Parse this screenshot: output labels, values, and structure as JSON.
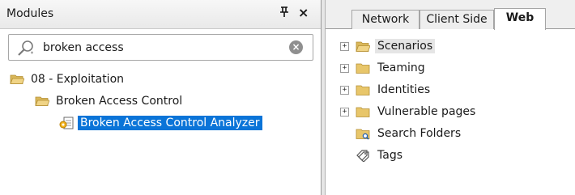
{
  "modules_panel": {
    "title": "Modules",
    "pin_glyph": "p",
    "close_glyph": "×",
    "search": {
      "value": "broken access",
      "placeholder": ""
    },
    "tree": [
      {
        "label": "08 - Exploitation",
        "icon": "folder-open-icon"
      },
      {
        "label": "Broken Access Control",
        "icon": "folder-open-icon"
      },
      {
        "label": "Broken Access Control Analyzer",
        "icon": "analyzer-icon",
        "selected": true
      }
    ]
  },
  "right_panel": {
    "tabs": [
      {
        "label": "Network"
      },
      {
        "label": "Client Side"
      },
      {
        "label": "Web",
        "active": true
      }
    ],
    "tree": [
      {
        "label": "Scenarios",
        "expandable": true,
        "icon": "folder-open-icon",
        "highlighted": true
      },
      {
        "label": "Teaming",
        "expandable": true,
        "icon": "folder-icon"
      },
      {
        "label": "Identities",
        "expandable": true,
        "icon": "folder-icon"
      },
      {
        "label": "Vulnerable pages",
        "expandable": true,
        "icon": "folder-icon"
      },
      {
        "label": "Search Folders",
        "expandable": false,
        "icon": "search-folder-icon"
      },
      {
        "label": "Tags",
        "expandable": false,
        "icon": "tag-icon"
      }
    ]
  },
  "colors": {
    "selection": "#0a74d8",
    "folder": "#e8c66a"
  }
}
